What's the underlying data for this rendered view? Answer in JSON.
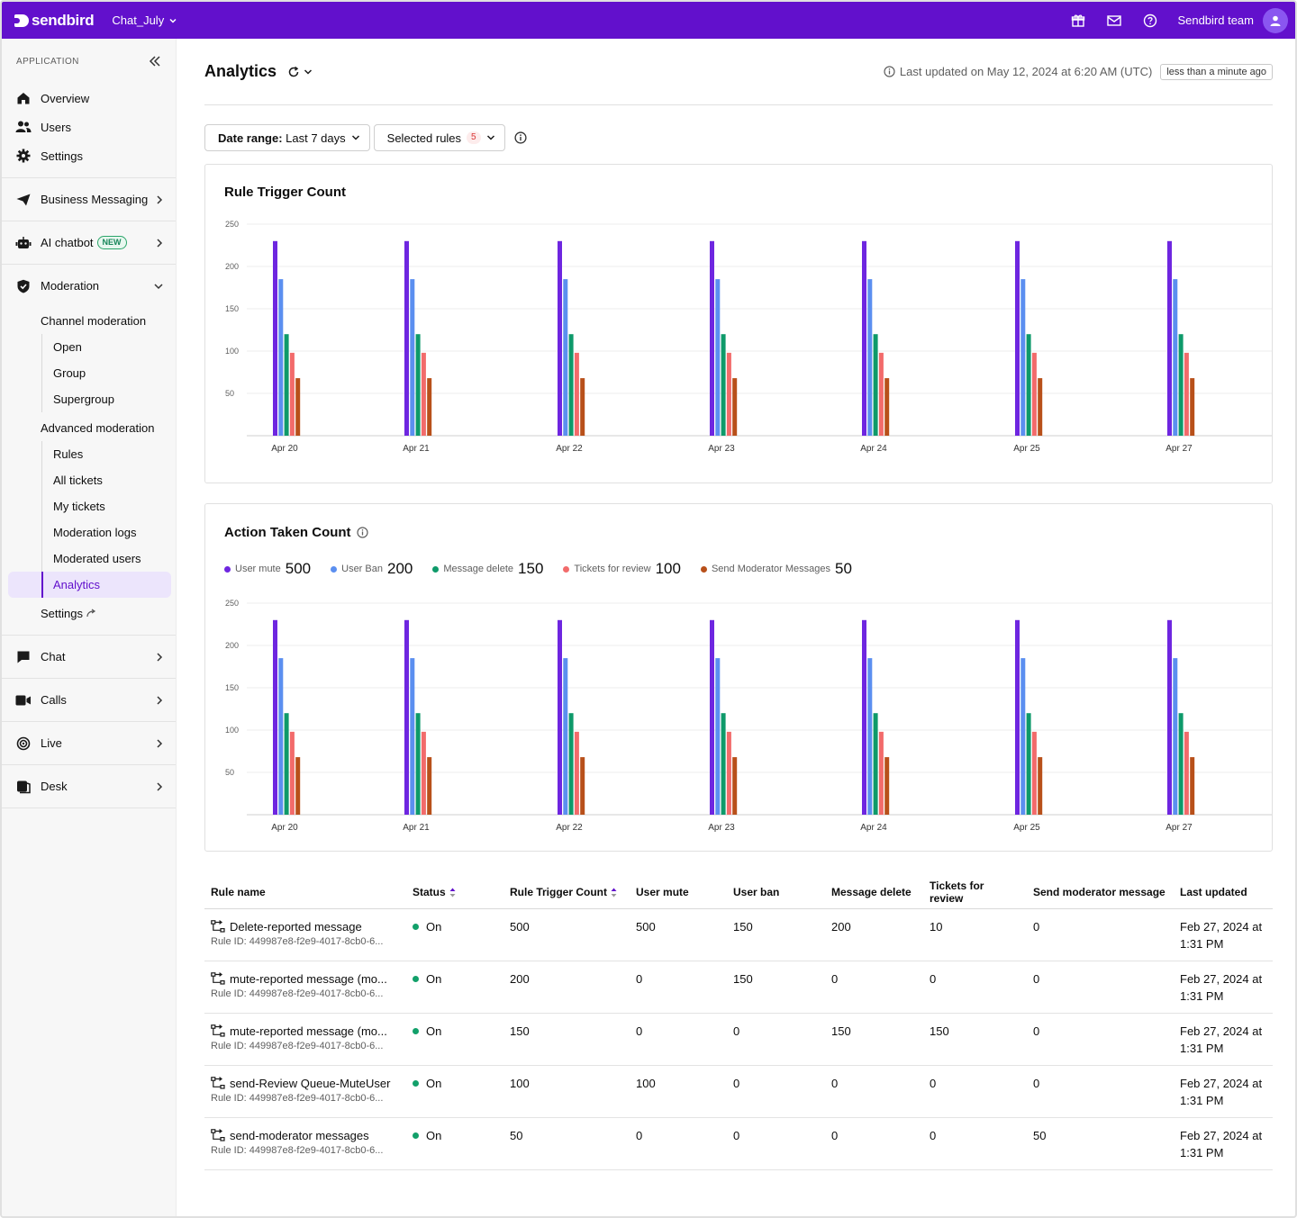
{
  "topbar": {
    "logo_text": "sendbird",
    "app_name": "Chat_July",
    "team_name": "Sendbird team",
    "brand_color": "#6210cc",
    "icons": [
      "gift-icon",
      "mail-icon",
      "help-icon",
      "user-icon"
    ]
  },
  "sidebar": {
    "section_label": "APPLICATION",
    "top_items": [
      {
        "label": "Overview",
        "icon": "home-icon"
      },
      {
        "label": "Users",
        "icon": "users-icon"
      },
      {
        "label": "Settings",
        "icon": "gear-icon"
      }
    ],
    "business_messaging": "Business Messaging",
    "ai_chatbot": "AI chatbot",
    "ai_badge": "NEW",
    "moderation": "Moderation",
    "channel_moderation": "Channel moderation",
    "channel_items": [
      "Open",
      "Group",
      "Supergroup"
    ],
    "advanced_moderation": "Advanced moderation",
    "advanced_items": [
      "Rules",
      "All tickets",
      "My tickets",
      "Moderation logs",
      "Moderated users",
      "Analytics"
    ],
    "settings": "Settings",
    "bottom_groups": [
      "Chat",
      "Calls",
      "Live",
      "Desk"
    ]
  },
  "header": {
    "title": "Analytics",
    "last_updated": "Last updated on May 12, 2024 at 6:20 AM (UTC)",
    "relative": "less than a minute ago"
  },
  "filters": {
    "date_label": "Date range:",
    "date_value": "Last 7 days",
    "rules_label": "Selected rules",
    "rules_count": "5"
  },
  "chart_data": [
    {
      "type": "bar",
      "title": "Rule Trigger Count",
      "categories": [
        "Apr 20",
        "Apr 21",
        "Apr 22",
        "Apr 23",
        "Apr 24",
        "Apr 25",
        "Apr 27"
      ],
      "ylim": [
        0,
        250
      ],
      "yticks": [
        50,
        100,
        150,
        200,
        250
      ],
      "colors": [
        "#6e26e0",
        "#5b8ff0",
        "#0e9a6a",
        "#f26b6b",
        "#b8501a"
      ],
      "series": [
        {
          "values": [
            230,
            185,
            120,
            98,
            68
          ]
        },
        {
          "values": [
            230,
            185,
            120,
            98,
            68
          ]
        },
        {
          "values": [
            230,
            185,
            120,
            98,
            68
          ]
        },
        {
          "values": [
            230,
            185,
            120,
            98,
            68
          ]
        },
        {
          "values": [
            230,
            185,
            120,
            98,
            68
          ]
        },
        {
          "values": [
            230,
            185,
            120,
            98,
            68
          ]
        },
        {
          "values": [
            230,
            185,
            120,
            98,
            68
          ]
        }
      ]
    },
    {
      "type": "bar",
      "title": "Action Taken Count",
      "legend": [
        {
          "name": "User mute",
          "total": "500",
          "color": "#6e26e0"
        },
        {
          "name": "User Ban",
          "total": "200",
          "color": "#5b8ff0"
        },
        {
          "name": "Message delete",
          "total": "150",
          "color": "#0e9a6a"
        },
        {
          "name": "Tickets for review",
          "total": "100",
          "color": "#f26b6b"
        },
        {
          "name": "Send Moderator Messages",
          "total": "50",
          "color": "#b8501a"
        }
      ],
      "categories": [
        "Apr 20",
        "Apr 21",
        "Apr 22",
        "Apr 23",
        "Apr 24",
        "Apr 25",
        "Apr 27"
      ],
      "ylim": [
        0,
        250
      ],
      "yticks": [
        50,
        100,
        150,
        200,
        250
      ],
      "series_names": [
        "User mute",
        "User Ban",
        "Message delete",
        "Tickets for review",
        "Send Moderator Messages"
      ],
      "values_by_category": [
        [
          230,
          185,
          120,
          98,
          68
        ],
        [
          230,
          185,
          120,
          98,
          68
        ],
        [
          230,
          185,
          120,
          98,
          68
        ],
        [
          230,
          185,
          120,
          98,
          68
        ],
        [
          230,
          185,
          120,
          98,
          68
        ],
        [
          230,
          185,
          120,
          98,
          68
        ],
        [
          230,
          185,
          120,
          98,
          68
        ]
      ]
    }
  ],
  "table": {
    "headers": [
      "Rule name",
      "Status",
      "Rule Trigger Count",
      "User mute",
      "User ban",
      "Message delete",
      "Tickets for review",
      "Send moderator message",
      "Last updated"
    ],
    "rows": [
      {
        "name": "Delete-reported message",
        "id": "Rule ID: 449987e8-f2e9-4017-8cb0-6...",
        "status": "On",
        "trigger": "500",
        "mute": "500",
        "ban": "150",
        "delete": "200",
        "review": "10",
        "send": "0",
        "updated1": "Feb 27, 2024 at",
        "updated2": "1:31 PM"
      },
      {
        "name": "mute-reported message (mo...",
        "id": "Rule ID: 449987e8-f2e9-4017-8cb0-6...",
        "status": "On",
        "trigger": "200",
        "mute": "0",
        "ban": "150",
        "delete": "0",
        "review": "0",
        "send": "0",
        "updated1": "Feb 27, 2024 at",
        "updated2": "1:31 PM"
      },
      {
        "name": "mute-reported message (mo...",
        "id": "Rule ID: 449987e8-f2e9-4017-8cb0-6...",
        "status": "On",
        "trigger": "150",
        "mute": "0",
        "ban": "0",
        "delete": "150",
        "review": "150",
        "send": "0",
        "updated1": "Feb 27, 2024 at",
        "updated2": "1:31 PM"
      },
      {
        "name": "send-Review Queue-MuteUser",
        "id": "Rule ID: 449987e8-f2e9-4017-8cb0-6...",
        "status": "On",
        "trigger": "100",
        "mute": "100",
        "ban": "0",
        "delete": "0",
        "review": "0",
        "send": "0",
        "updated1": "Feb 27, 2024 at",
        "updated2": "1:31 PM"
      },
      {
        "name": "send-moderator messages",
        "id": "Rule ID: 449987e8-f2e9-4017-8cb0-6...",
        "status": "On",
        "trigger": "50",
        "mute": "0",
        "ban": "0",
        "delete": "0",
        "review": "0",
        "send": "50",
        "updated1": "Feb 27, 2024 at",
        "updated2": "1:31 PM"
      }
    ]
  }
}
